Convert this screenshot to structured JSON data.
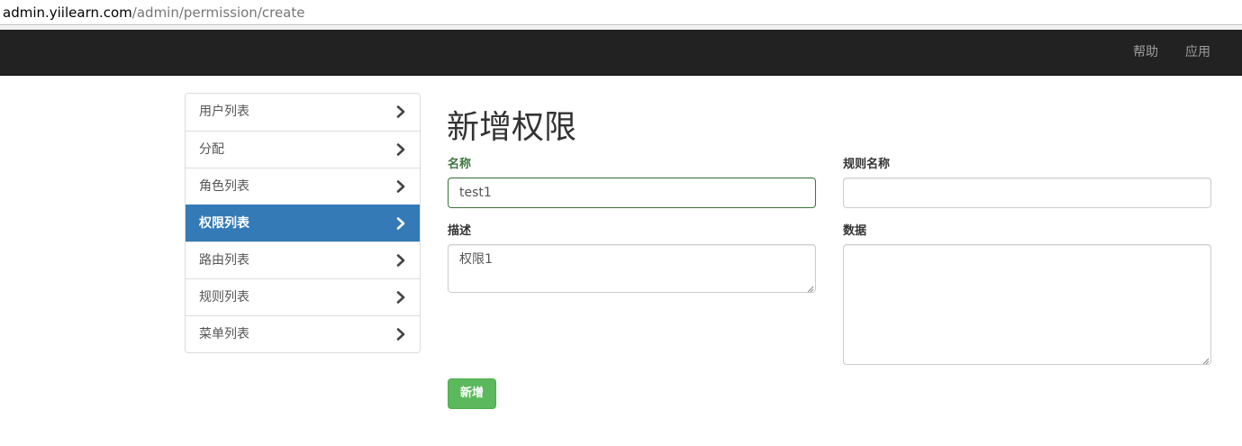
{
  "browser": {
    "url_host": "admin.yiilearn.com",
    "url_path": "/admin/permission/create"
  },
  "navbar": {
    "help_label": "帮助",
    "app_label": "应用"
  },
  "sidebar": {
    "items": [
      {
        "label": "用户列表",
        "active": false
      },
      {
        "label": "分配",
        "active": false
      },
      {
        "label": "角色列表",
        "active": false
      },
      {
        "label": "权限列表",
        "active": true
      },
      {
        "label": "路由列表",
        "active": false
      },
      {
        "label": "规则列表",
        "active": false
      },
      {
        "label": "菜单列表",
        "active": false
      }
    ]
  },
  "form": {
    "title": "新增权限",
    "name_label": "名称",
    "name_value": "test1",
    "rule_label": "规则名称",
    "rule_value": "",
    "description_label": "描述",
    "description_value": "权限1",
    "data_label": "数据",
    "data_value": "",
    "submit_label": "新增"
  },
  "colors": {
    "navbar_bg": "#222222",
    "active_item": "#337ab7",
    "success_text": "#3c763d",
    "submit_button": "#5cb85c"
  }
}
